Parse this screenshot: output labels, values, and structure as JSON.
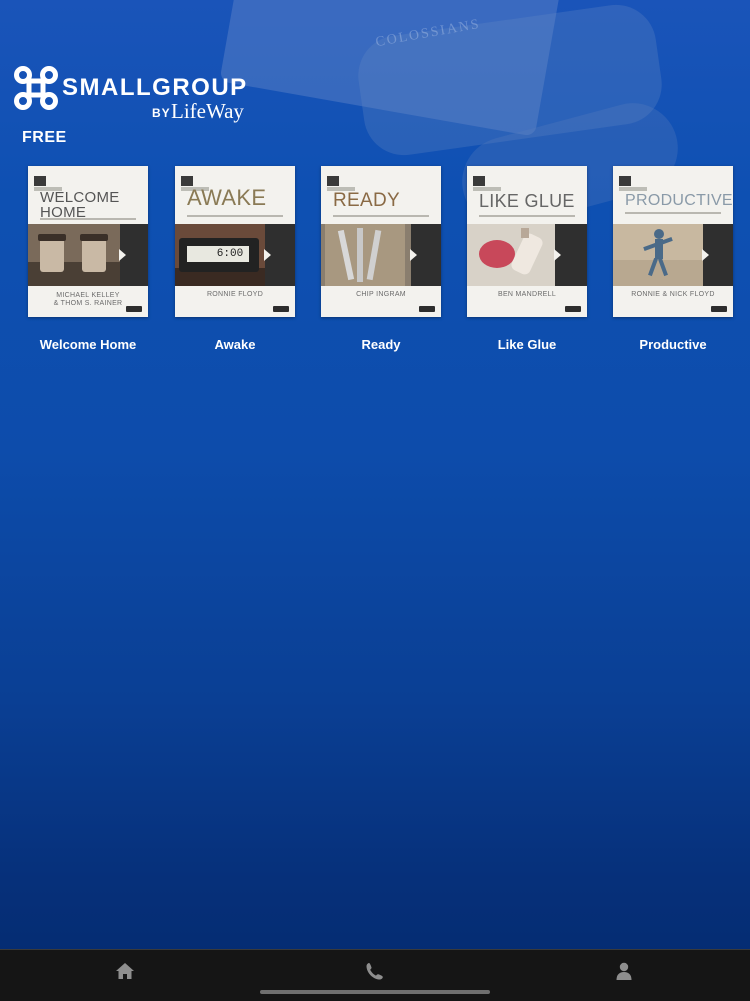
{
  "brand": {
    "name": "SMALLGROUP",
    "by": "BY",
    "partner": "LifeWay"
  },
  "background": {
    "photo_text": "COLOSSIANS"
  },
  "section": {
    "label": "FREE"
  },
  "studies": [
    {
      "label": "Welcome Home",
      "cover_title_line1": "WELCOME",
      "cover_title_line2": "HOME",
      "cover_author_line1": "MICHAEL KELLEY",
      "cover_author_line2": "& THOM S. RAINER"
    },
    {
      "label": "Awake",
      "cover_title_line1": "AWAKE",
      "cover_clock": "6:00",
      "cover_author_line1": "RONNIE FLOYD"
    },
    {
      "label": "Ready",
      "cover_title_line1": "READY",
      "cover_author_line1": "CHIP INGRAM"
    },
    {
      "label": "Like Glue",
      "cover_title_line1": "LIKE GLUE",
      "cover_author_line1": "BEN MANDRELL"
    },
    {
      "label": "Productive",
      "cover_title_line1": "PRODUCTIVE",
      "cover_author_line1": "RONNIE & NICK FLOYD"
    }
  ],
  "tabbar": {
    "tabs": [
      {
        "icon": "home-icon"
      },
      {
        "icon": "phone-icon"
      },
      {
        "icon": "person-icon"
      }
    ]
  },
  "colors": {
    "background_top": "#1a54b9",
    "background_bottom": "#042a6e",
    "tabbar": "#151515",
    "tab_icon": "#8e8e8e"
  }
}
